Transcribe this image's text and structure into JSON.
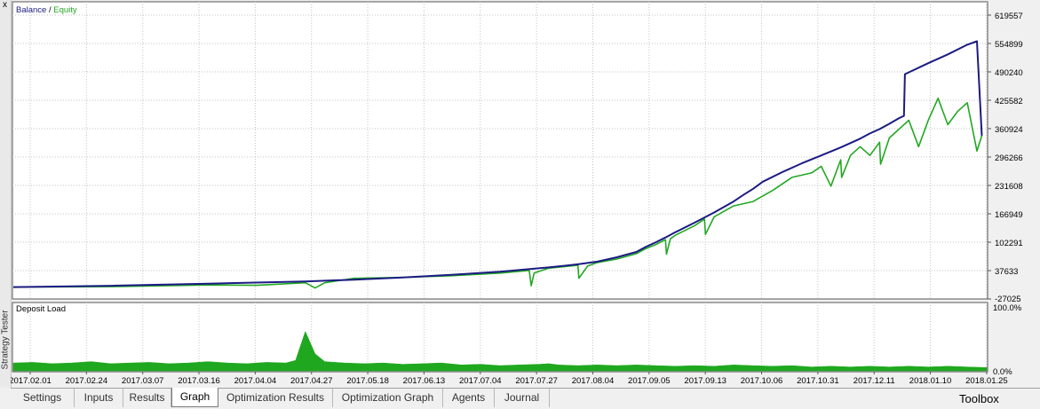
{
  "window": {
    "close_glyph": "x",
    "side_title": "Strategy Tester"
  },
  "tabs": [
    {
      "label": "Settings"
    },
    {
      "label": "Inputs"
    },
    {
      "label": "Results"
    },
    {
      "label": "Graph",
      "active": true
    },
    {
      "label": "Optimization Results"
    },
    {
      "label": "Optimization Graph"
    },
    {
      "label": "Agents"
    },
    {
      "label": "Journal"
    }
  ],
  "toolbox_label": "Toolbox",
  "colors": {
    "balance": "#1b1b83",
    "equity": "#22a822",
    "deposit_load": "#1fa81f",
    "grid": "#c4c4c4",
    "plot_bg": "#ffffff"
  },
  "chart_data": [
    {
      "type": "line",
      "legend": [
        {
          "label": "Balance",
          "color": "#1b1b83"
        },
        {
          "label": "Equity",
          "color": "#22a822"
        }
      ],
      "legend_separator": "/",
      "yticks": [
        "619557",
        "554899",
        "490240",
        "425582",
        "360924",
        "296266",
        "231608",
        "166949",
        "102291",
        "37633",
        "-27025"
      ],
      "ylim": [
        -27025,
        619557
      ],
      "xticks": [
        "2017.02.01",
        "2017.02.24",
        "2017.03.07",
        "2017.03.16",
        "2017.04.04",
        "2017.04.27",
        "2017.05.18",
        "2017.06.13",
        "2017.07.04",
        "2017.07.27",
        "2017.08.04",
        "2017.09.05",
        "2017.09.13",
        "2017.10.06",
        "2017.10.31",
        "2017.12.11",
        "2018.01.10",
        "2018.01.25"
      ],
      "grid": true,
      "series": [
        {
          "name": "Balance",
          "color": "#1b1b83",
          "x": [
            0,
            10,
            20,
            30,
            35,
            40,
            45,
            50,
            55,
            58,
            60,
            62,
            64,
            65,
            66,
            67,
            68,
            70,
            72,
            74,
            75,
            76,
            77,
            79,
            81,
            83,
            85,
            87,
            88,
            89,
            90,
            91,
            91.5,
            91.6,
            94,
            96,
            98,
            99,
            99.5
          ],
          "y": [
            0,
            3000,
            8000,
            13000,
            17000,
            22000,
            28000,
            35000,
            45000,
            52000,
            58000,
            68000,
            80000,
            92000,
            102000,
            113000,
            125000,
            147000,
            170000,
            195000,
            210000,
            224000,
            240000,
            262000,
            282000,
            300000,
            318000,
            338000,
            350000,
            360000,
            372000,
            385000,
            390000,
            485000,
            510000,
            530000,
            552000,
            560000,
            345000
          ]
        },
        {
          "name": "Equity",
          "color": "#22a822",
          "x": [
            0,
            10,
            20,
            25,
            30,
            31,
            32,
            35,
            40,
            45,
            50,
            53,
            53.2,
            53.5,
            55,
            58,
            58.1,
            59,
            60,
            62,
            64,
            65,
            66,
            67,
            67.1,
            67.5,
            68,
            70,
            71,
            71.1,
            72,
            74,
            76,
            78,
            80,
            82,
            83,
            84,
            85,
            85.1,
            86,
            87,
            88,
            89,
            89.1,
            90,
            91,
            92,
            93,
            94,
            95,
            96,
            97,
            98,
            99,
            99.5
          ],
          "y": [
            0,
            1000,
            5000,
            4000,
            10000,
            -2000,
            10000,
            20000,
            22000,
            26000,
            32000,
            38000,
            3000,
            32000,
            43000,
            50000,
            20000,
            48000,
            56000,
            64000,
            76000,
            88000,
            97000,
            108000,
            75000,
            110000,
            118000,
            140000,
            155000,
            120000,
            160000,
            185000,
            195000,
            220000,
            250000,
            260000,
            275000,
            230000,
            290000,
            250000,
            300000,
            320000,
            300000,
            330000,
            280000,
            340000,
            360000,
            380000,
            320000,
            380000,
            430000,
            370000,
            400000,
            420000,
            310000,
            345000
          ]
        }
      ]
    },
    {
      "type": "area",
      "title": "Deposit Load",
      "yticks": [
        "100.0%",
        "0.0%"
      ],
      "ylim": [
        0,
        100
      ],
      "x": [
        0,
        2,
        4,
        6,
        8,
        10,
        12,
        14,
        16,
        18,
        20,
        22,
        24,
        26,
        28,
        29,
        30,
        31,
        32,
        34,
        36,
        38,
        40,
        42,
        44,
        46,
        48,
        50,
        52,
        54,
        55,
        56,
        58,
        60,
        62,
        64,
        66,
        68,
        70,
        72,
        74,
        76,
        78,
        80,
        82,
        84,
        86,
        88,
        90,
        92,
        94,
        96,
        98,
        100
      ],
      "y": [
        12,
        13,
        11,
        12,
        14,
        11,
        12,
        13,
        11,
        12,
        14,
        12,
        11,
        13,
        12,
        16,
        60,
        26,
        14,
        12,
        11,
        12,
        10,
        11,
        12,
        9,
        10,
        8,
        9,
        10,
        11,
        9,
        8,
        9,
        8,
        9,
        8,
        7,
        8,
        7,
        9,
        8,
        7,
        8,
        6,
        7,
        6,
        7,
        6,
        7,
        6,
        7,
        6,
        5
      ]
    }
  ]
}
